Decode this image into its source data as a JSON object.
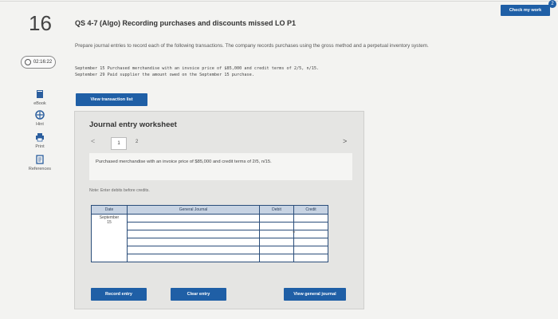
{
  "header": {
    "question_number": "16",
    "title": "QS 4-7 (Algo) Recording purchases and discounts missed LO P1",
    "check_button": "Check my work",
    "badge": "2"
  },
  "timer": {
    "value": "02:16:22"
  },
  "sidebar": {
    "items": [
      {
        "label": "eBook",
        "icon": "book-icon"
      },
      {
        "label": "Hint",
        "icon": "hint-icon"
      },
      {
        "label": "Print",
        "icon": "print-icon"
      },
      {
        "label": "References",
        "icon": "references-icon"
      }
    ]
  },
  "question": {
    "intro": "Prepare journal entries to record each of the following transactions. The company records purchases using the gross method and a perpetual inventory system.",
    "transaction_1": "September 15 Purchased merchandise with an invoice price of $85,000 and credit terms of 2/5, n/15.",
    "transaction_2": "September 29 Paid supplier the amount owed on the September 15 purchase.",
    "view_transaction_button": "View transaction list"
  },
  "worksheet": {
    "title": "Journal entry worksheet",
    "nav_prev": "<",
    "nav_next": ">",
    "tabs": [
      "1",
      "2"
    ],
    "description": "Purchased merchandise with an invoice price of $85,000 and credit terms of 2/5, n/15.",
    "note": "Note: Enter debits before credits.",
    "table": {
      "headers": [
        "Date",
        "General Journal",
        "Debit",
        "Credit"
      ],
      "date_value_line1": "September",
      "date_value_line2": "15"
    },
    "buttons": {
      "record": "Record entry",
      "clear": "Clear entry",
      "view_journal": "View general journal"
    }
  }
}
